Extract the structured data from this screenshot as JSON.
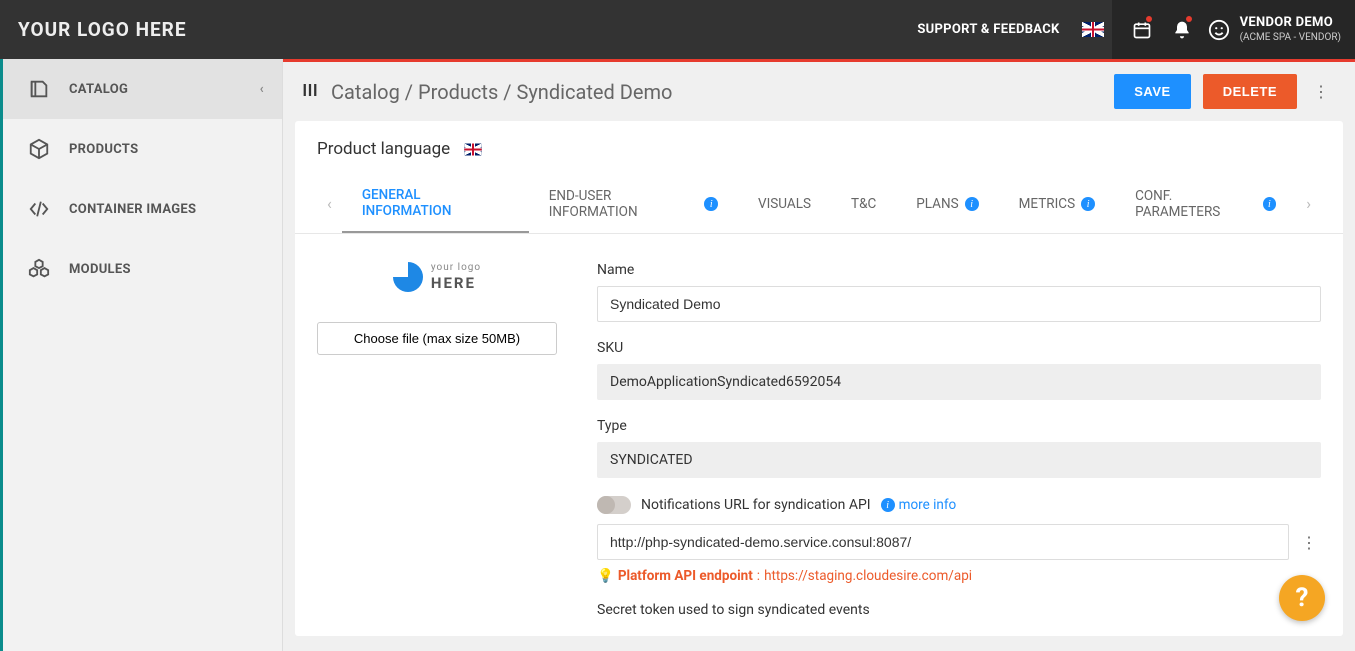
{
  "header": {
    "logo_text": "YOUR LOGO HERE",
    "support_link": "SUPPORT & FEEDBACK",
    "user_name": "VENDOR DEMO",
    "user_sub": "(ACME SPA - VENDOR)"
  },
  "sidebar": {
    "items": [
      {
        "label": "CATALOG",
        "icon": "catalog",
        "active": true,
        "expandable": true
      },
      {
        "label": "PRODUCTS",
        "icon": "products"
      },
      {
        "label": "CONTAINER IMAGES",
        "icon": "container"
      },
      {
        "label": "MODULES",
        "icon": "modules"
      }
    ]
  },
  "breadcrumb": {
    "parts": [
      "Catalog",
      "Products",
      "Syndicated Demo"
    ]
  },
  "actions": {
    "save": "SAVE",
    "delete": "DELETE"
  },
  "product_language_label": "Product language",
  "tabs": [
    {
      "label": "GENERAL INFORMATION",
      "active": true
    },
    {
      "label": "END-USER INFORMATION",
      "info": true
    },
    {
      "label": "VISUALS"
    },
    {
      "label": "T&C"
    },
    {
      "label": "PLANS",
      "info": true
    },
    {
      "label": "METRICS",
      "info": true
    },
    {
      "label": "CONF. PARAMETERS",
      "info": true
    }
  ],
  "form": {
    "logo_small": "your logo",
    "logo_big": "HERE",
    "choose_file": "Choose file (max size 50MB)",
    "name_label": "Name",
    "name_value": "Syndicated Demo",
    "sku_label": "SKU",
    "sku_value": "DemoApplicationSyndicated6592054",
    "type_label": "Type",
    "type_value": "SYNDICATED",
    "notif_label": "Notifications URL for syndication API",
    "more_info": "more info",
    "notif_value": "http://php-syndicated-demo.service.consul:8087/",
    "endpoint_label": "Platform API endpoint",
    "endpoint_url": "https://staging.cloudesire.com/api",
    "secret_label": "Secret token used to sign syndicated events"
  }
}
